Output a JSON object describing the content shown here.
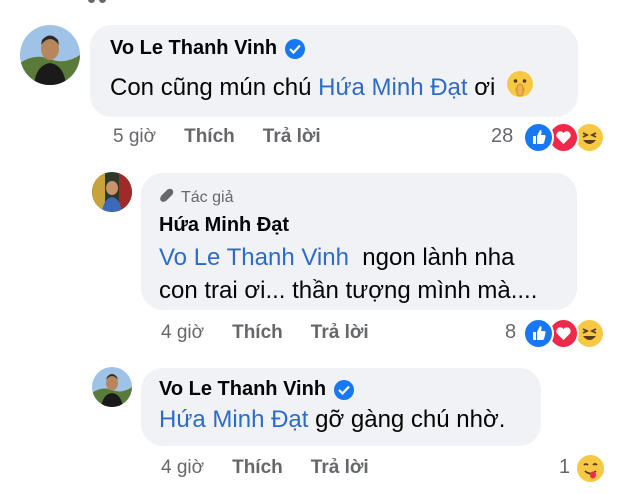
{
  "comments": [
    {
      "author": "Vo Le Thanh Vinh",
      "verified": true,
      "text_parts": [
        "Con cũng mún chú ",
        "Hứa Minh Đạt",
        " ơi "
      ],
      "emoji": "shushing-face",
      "time": "5 giờ",
      "like": "Thích",
      "reply": "Trả lời",
      "reaction_count": "28",
      "reactions": [
        "like",
        "love",
        "haha"
      ]
    },
    {
      "badge": "Tác giả",
      "author": "Hứa Minh Đạt",
      "verified": false,
      "text_parts": [
        "Vo Le Thanh Vinh",
        "  ngon lành nha",
        "con trai ơi... thần tượng mình mà...."
      ],
      "time": "4 giờ",
      "like": "Thích",
      "reply": "Trả lời",
      "reaction_count": "8",
      "reactions": [
        "like",
        "love",
        "haha"
      ]
    },
    {
      "author": "Vo Le Thanh Vinh",
      "verified": true,
      "text_parts": [
        "Hứa Minh Đạt",
        " gỡ gàng chú nhờ."
      ],
      "time": "4 giờ",
      "like": "Thích",
      "reply": "Trả lời",
      "reaction_count": "1",
      "reactions": [
        "yum"
      ]
    }
  ],
  "colors": {
    "mention": "#2d6bc9",
    "bubble": "#f0f2f5",
    "meta": "#65676b",
    "like": "#1877f2",
    "love": "#f02849",
    "haha": "#f7c843"
  }
}
